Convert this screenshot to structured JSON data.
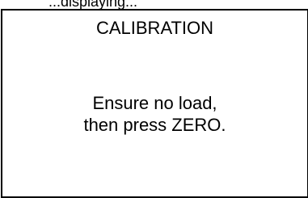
{
  "top_fragment_text": "...displaying...",
  "screen": {
    "title": "CALIBRATION",
    "message_line_1": "Ensure no load,",
    "message_line_2": "then press ZERO."
  }
}
